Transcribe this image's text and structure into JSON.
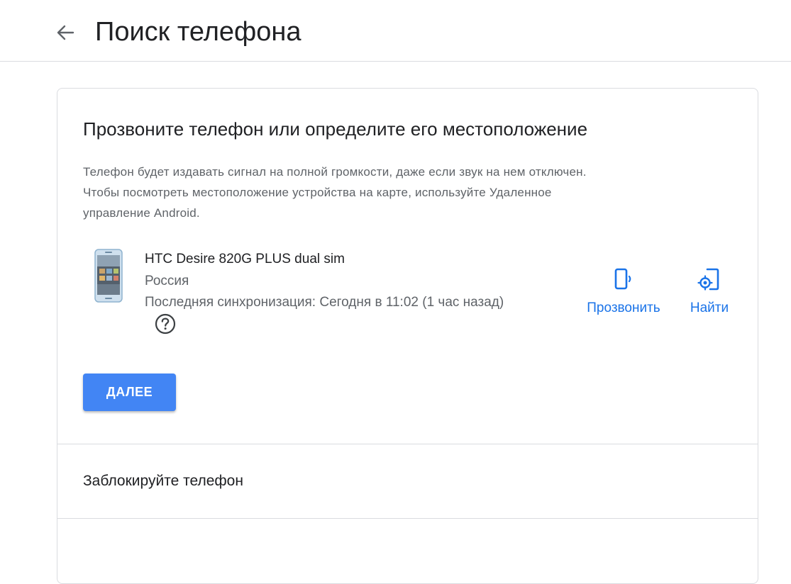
{
  "header": {
    "title": "Поиск телефона",
    "back_icon": "arrow-left-icon"
  },
  "card": {
    "title": "Прозвоните телефон или определите его местоположение",
    "description_lines": [
      "Телефон будет издавать сигнал на полной громкости, даже если звук на нем отключен.",
      "Чтобы посмотреть местоположение устройства на карте, используйте Удаленное",
      "управление Android."
    ],
    "device": {
      "name": "HTC Desire 820G PLUS dual sim",
      "country": "Россия",
      "last_sync": "Последняя синхронизация: Сегодня в 11:02 (1 час назад)",
      "help_icon": "help-circle-icon"
    },
    "actions": {
      "ring": {
        "label": "Прозвонить",
        "icon": "phone-ring-icon"
      },
      "find": {
        "label": "Найти",
        "icon": "locate-device-icon"
      }
    },
    "next_button": "ДАЛЕЕ",
    "lock_section": "Заблокируйте телефон"
  },
  "colors": {
    "accent": "#1a73e8",
    "button": "#4285f4",
    "divider": "#dadce0",
    "secondary_text": "#5f6368"
  }
}
